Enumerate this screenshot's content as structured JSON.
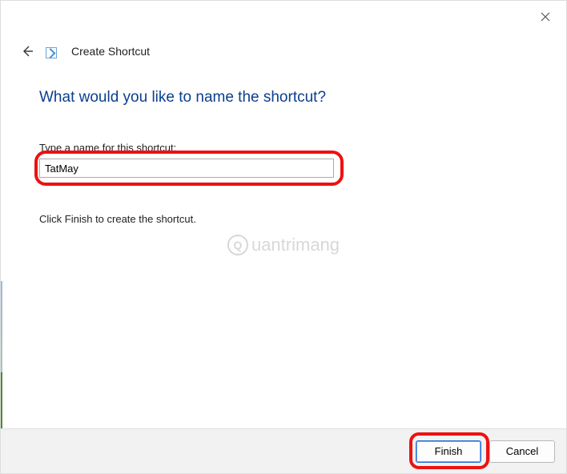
{
  "window": {
    "title": "Create Shortcut"
  },
  "heading": "What would you like to name the shortcut?",
  "field": {
    "label": "Type a name for this shortcut:",
    "value": "TatMay"
  },
  "instruction": "Click Finish to create the shortcut.",
  "watermark": "uantrimang",
  "buttons": {
    "finish": "Finish",
    "cancel": "Cancel"
  }
}
